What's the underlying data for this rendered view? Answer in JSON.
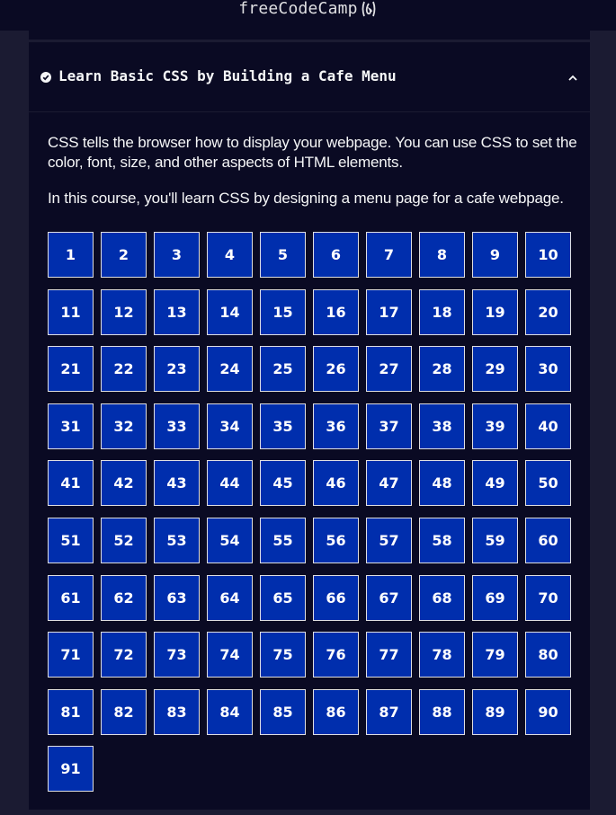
{
  "navbar": {
    "brand": "freeCodeCamp"
  },
  "block": {
    "title": "Learn Basic CSS by Building a Cafe Menu",
    "description_1": "CSS tells the browser how to display your webpage. You can use CSS to set the color, font, size, and other aspects of HTML elements.",
    "description_2": "In this course, you'll learn CSS by designing a menu page for a cafe webpage."
  },
  "steps": [
    "1",
    "2",
    "3",
    "4",
    "5",
    "6",
    "7",
    "8",
    "9",
    "10",
    "11",
    "12",
    "13",
    "14",
    "15",
    "16",
    "17",
    "18",
    "19",
    "20",
    "21",
    "22",
    "23",
    "24",
    "25",
    "26",
    "27",
    "28",
    "29",
    "30",
    "31",
    "32",
    "33",
    "34",
    "35",
    "36",
    "37",
    "38",
    "39",
    "40",
    "41",
    "42",
    "43",
    "44",
    "45",
    "46",
    "47",
    "48",
    "49",
    "50",
    "51",
    "52",
    "53",
    "54",
    "55",
    "56",
    "57",
    "58",
    "59",
    "60",
    "61",
    "62",
    "63",
    "64",
    "65",
    "66",
    "67",
    "68",
    "69",
    "70",
    "71",
    "72",
    "73",
    "74",
    "75",
    "76",
    "77",
    "78",
    "79",
    "80",
    "81",
    "82",
    "83",
    "84",
    "85",
    "86",
    "87",
    "88",
    "89",
    "90",
    "91"
  ],
  "colors": {
    "page_bg": "#1b1b32",
    "panel_bg": "#0a0a23",
    "step_bg": "#002ead",
    "text": "#f5f6f7"
  },
  "icons": {
    "completion": "check-circle-icon",
    "collapse": "caret-up-icon",
    "logo": "flame-icon"
  }
}
